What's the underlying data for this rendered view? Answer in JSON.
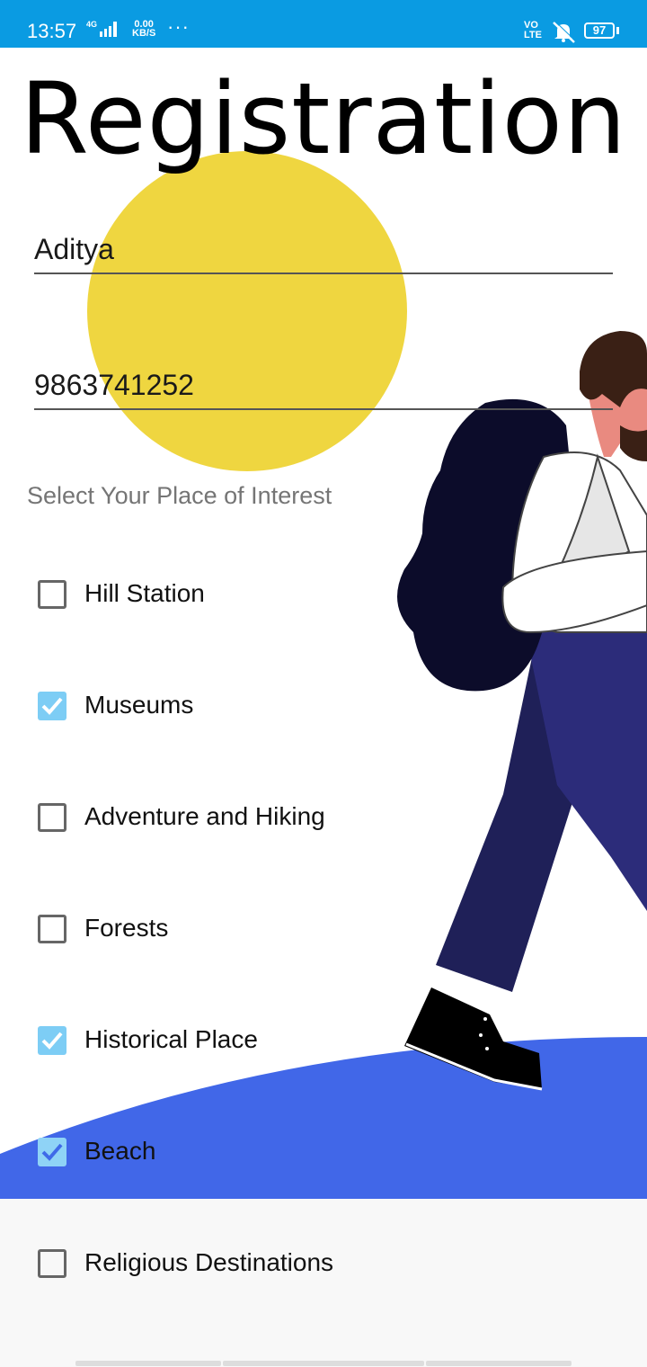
{
  "status_bar": {
    "time": "13:57",
    "network": "4G",
    "speed_value": "0.00",
    "speed_unit": "KB/S",
    "more": "···",
    "volte_line1": "VO",
    "volte_line2": "LTE",
    "battery": "97"
  },
  "form": {
    "title": "Registration",
    "name_value": "Aditya",
    "phone_value": "9863741252",
    "interest_label": "Select Your Place of Interest",
    "options": [
      {
        "label": "Hill Station",
        "checked": false
      },
      {
        "label": "Museums",
        "checked": true
      },
      {
        "label": "Adventure and Hiking",
        "checked": false
      },
      {
        "label": "Forests",
        "checked": false
      },
      {
        "label": "Historical Place",
        "checked": true
      },
      {
        "label": "Beach",
        "checked": true
      },
      {
        "label": "Religious Destinations",
        "checked": false
      }
    ]
  },
  "colors": {
    "status_bar": "#0a9be2",
    "circle": "#efd640",
    "hill": "#4167e8",
    "checkbox_checked": "#7dcdf5"
  }
}
